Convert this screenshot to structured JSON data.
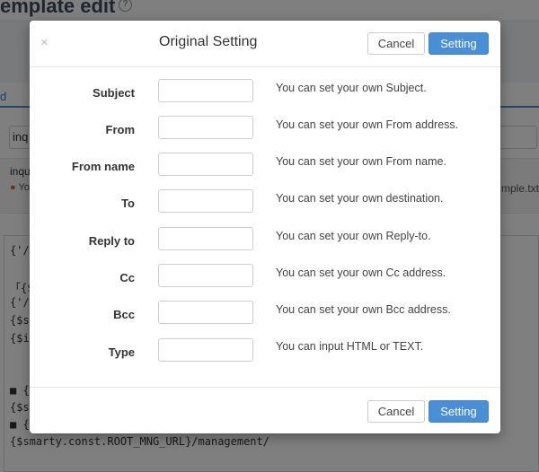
{
  "background": {
    "page_title": "emplate edit",
    "tab_label": "d",
    "search_value": "inq",
    "row_name": "inqu",
    "row_location": "Yo",
    "row_file": "mple.txt",
    "code_lines": [
      "{'/m",
      " 「{$",
      "{'/m",
      "{$sm",
      "{$im",
      "",
      "",
      "■ {$",
      "{$sm",
      "■ {'",
      "{$smarty.const.ROOT_MNG_URL}/management/"
    ]
  },
  "modal": {
    "title": "Original Setting",
    "close_glyph": "×",
    "cancel_label": "Cancel",
    "setting_label": "Setting",
    "fields": [
      {
        "label": "Subject",
        "value": "",
        "help": "You can set your own Subject."
      },
      {
        "label": "From",
        "value": "",
        "help": "You can set your own From address."
      },
      {
        "label": "From name",
        "value": "",
        "help": "You can set your own From name."
      },
      {
        "label": "To",
        "value": "",
        "help": "You can set your own destination."
      },
      {
        "label": "Reply to",
        "value": "",
        "help": "You can set your own Reply-to."
      },
      {
        "label": "Cc",
        "value": "",
        "help": "You can set your own Cc address."
      },
      {
        "label": "Bcc",
        "value": "",
        "help": "You can set your own Bcc address."
      },
      {
        "label": "Type",
        "value": "",
        "help": "You can input HTML or TEXT."
      }
    ]
  },
  "colors": {
    "primary": "#4a8fd6",
    "overlay": "rgba(0,0,0,0.5)"
  }
}
